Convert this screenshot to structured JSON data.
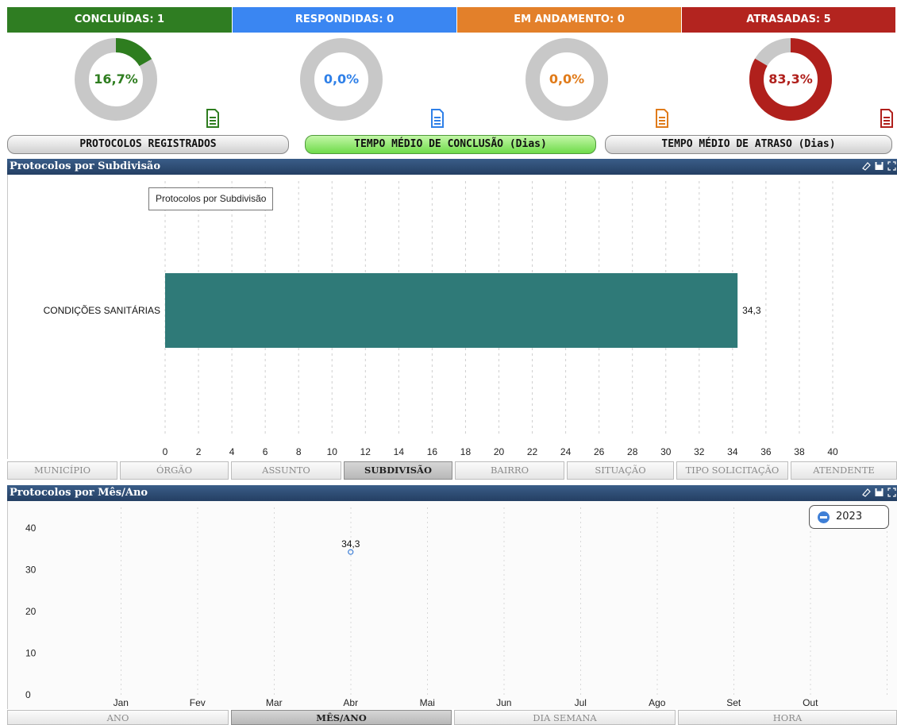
{
  "kpis": [
    {
      "label": "CONCLUÍDAS: 1",
      "percent_text": "16,7%",
      "fraction": 0.167,
      "color": "#2e7d1f",
      "header_color": "#2f7d22",
      "icon": "document-icon"
    },
    {
      "label": "RESPONDIDAS: 0",
      "percent_text": "0,0%",
      "fraction": 0.0,
      "color": "#2f80e8",
      "header_color": "#3a86f2",
      "icon": "document-icon"
    },
    {
      "label": "EM ANDAMENTO: 0",
      "percent_text": "0,0%",
      "fraction": 0.0,
      "color": "#e07b1a",
      "header_color": "#e3802a",
      "icon": "document-icon"
    },
    {
      "label": "ATRASADAS: 5",
      "percent_text": "83,3%",
      "fraction": 0.833,
      "color": "#b0201c",
      "header_color": "#b3241f",
      "icon": "document-icon"
    }
  ],
  "metric_tabs": [
    {
      "label": "PROTOCOLOS REGISTRADOS",
      "active": false
    },
    {
      "label": "TEMPO MÉDIO DE CONCLUSÃO (Dias)",
      "active": true
    },
    {
      "label": "TEMPO MÉDIO DE ATRASO (Dias)",
      "active": false
    }
  ],
  "subdivision_panel": {
    "title": "Protocolos por Subdivisão",
    "tooltip": "Protocolos por Subdivisão",
    "tools": [
      "eraser-icon",
      "save-icon",
      "expand-icon"
    ]
  },
  "group_tabs": [
    {
      "label": "MUNICÍPIO",
      "active": false
    },
    {
      "label": "ÓRGÃO",
      "active": false
    },
    {
      "label": "ASSUNTO",
      "active": false
    },
    {
      "label": "SUBDIVISÃO",
      "active": true
    },
    {
      "label": "BAIRRO",
      "active": false
    },
    {
      "label": "SITUAÇÃO",
      "active": false
    },
    {
      "label": "TIPO SOLICITAÇÃO",
      "active": false
    },
    {
      "label": "ATENDENTE",
      "active": false
    }
  ],
  "month_panel": {
    "title": "Protocolos por Mês/Ano",
    "year_button": "2023",
    "tools": [
      "eraser-icon",
      "save-icon",
      "expand-icon"
    ]
  },
  "time_tabs": [
    {
      "label": "ANO",
      "active": false
    },
    {
      "label": "MÊS/ANO",
      "active": true
    },
    {
      "label": "DIA SEMANA",
      "active": false
    },
    {
      "label": "HORA",
      "active": false
    }
  ],
  "chart_data": [
    {
      "type": "bar",
      "orientation": "horizontal",
      "categories": [
        "CONDIÇÕES SANITÁRIAS"
      ],
      "values": [
        34.3
      ],
      "value_labels": [
        "34,3"
      ],
      "xlim": [
        0,
        40
      ],
      "xticks": [
        "0",
        "2",
        "4",
        "6",
        "8",
        "10",
        "12",
        "14",
        "16",
        "18",
        "20",
        "22",
        "24",
        "26",
        "28",
        "30",
        "32",
        "34",
        "36",
        "38",
        "40"
      ],
      "bar_color": "#2f7a78",
      "grid": "vertical dashed"
    },
    {
      "type": "line",
      "categories": [
        "Jan",
        "Fev",
        "Mar",
        "Abr",
        "Mai",
        "Jun",
        "Jul",
        "Ago",
        "Set",
        "Out"
      ],
      "series": [
        {
          "name": "2023",
          "points": [
            {
              "x": "Abr",
              "y": 34.3,
              "label": "34,3"
            }
          ]
        }
      ],
      "yticks": [
        "0",
        "10",
        "20",
        "30",
        "40"
      ],
      "ylim": [
        0,
        45
      ],
      "marker_color": "#3f7fd6",
      "legend": "top-right"
    }
  ]
}
